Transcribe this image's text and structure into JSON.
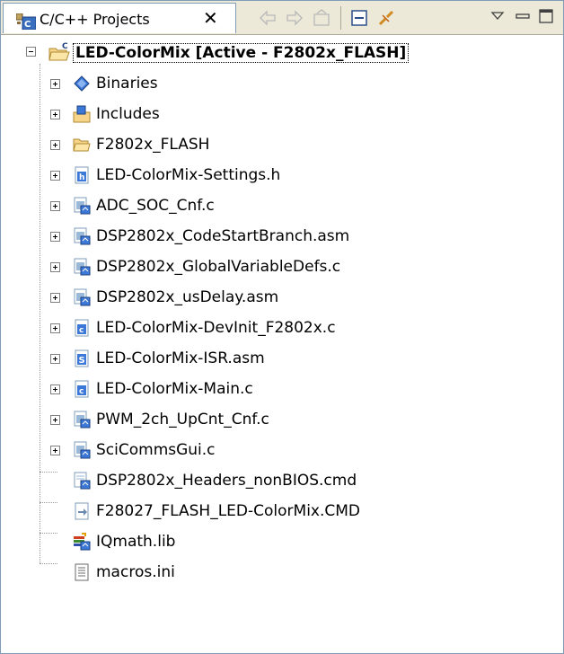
{
  "view": {
    "tab_title": "C/C++ Projects",
    "close_glyph": "✕"
  },
  "toolbar": {
    "buttons": [
      "back-arrow-icon",
      "forward-arrow-icon",
      "up-folder-icon",
      "collapse-all-icon",
      "link-with-editor-icon",
      "view-menu-icon",
      "minimize-icon",
      "maximize-icon"
    ]
  },
  "tree": {
    "root": {
      "label": "LED-ColorMix  [Active - F2802x_FLASH]",
      "icon": "project-folder-icon"
    },
    "items": [
      {
        "label": "Binaries",
        "icon": "binaries-icon",
        "expandable": true
      },
      {
        "label": "Includes",
        "icon": "includes-icon",
        "expandable": true
      },
      {
        "label": "F2802x_FLASH",
        "icon": "folder-icon",
        "expandable": true
      },
      {
        "label": "LED-ColorMix-Settings.h",
        "icon": "header-file-icon",
        "expandable": true
      },
      {
        "label": "ADC_SOC_Cnf.c",
        "icon": "linked-source-file-icon",
        "expandable": true
      },
      {
        "label": "DSP2802x_CodeStartBranch.asm",
        "icon": "linked-source-file-icon",
        "expandable": true
      },
      {
        "label": "DSP2802x_GlobalVariableDefs.c",
        "icon": "linked-source-file-icon",
        "expandable": true
      },
      {
        "label": "DSP2802x_usDelay.asm",
        "icon": "linked-source-file-icon",
        "expandable": true
      },
      {
        "label": "LED-ColorMix-DevInit_F2802x.c",
        "icon": "c-source-file-icon",
        "expandable": true
      },
      {
        "label": "LED-ColorMix-ISR.asm",
        "icon": "asm-source-file-icon",
        "expandable": true
      },
      {
        "label": "LED-ColorMix-Main.c",
        "icon": "c-source-file-icon",
        "expandable": true
      },
      {
        "label": "PWM_2ch_UpCnt_Cnf.c",
        "icon": "linked-source-file-icon",
        "expandable": true
      },
      {
        "label": "SciCommsGui.c",
        "icon": "linked-source-file-icon",
        "expandable": true
      },
      {
        "label": "DSP2802x_Headers_nonBIOS.cmd",
        "icon": "linked-file-icon",
        "expandable": false
      },
      {
        "label": "F28027_FLASH_LED-ColorMix.CMD",
        "icon": "cmd-file-icon",
        "expandable": false
      },
      {
        "label": "IQmath.lib",
        "icon": "library-file-icon",
        "expandable": false
      },
      {
        "label": "macros.ini",
        "icon": "text-file-icon",
        "expandable": false
      }
    ]
  }
}
